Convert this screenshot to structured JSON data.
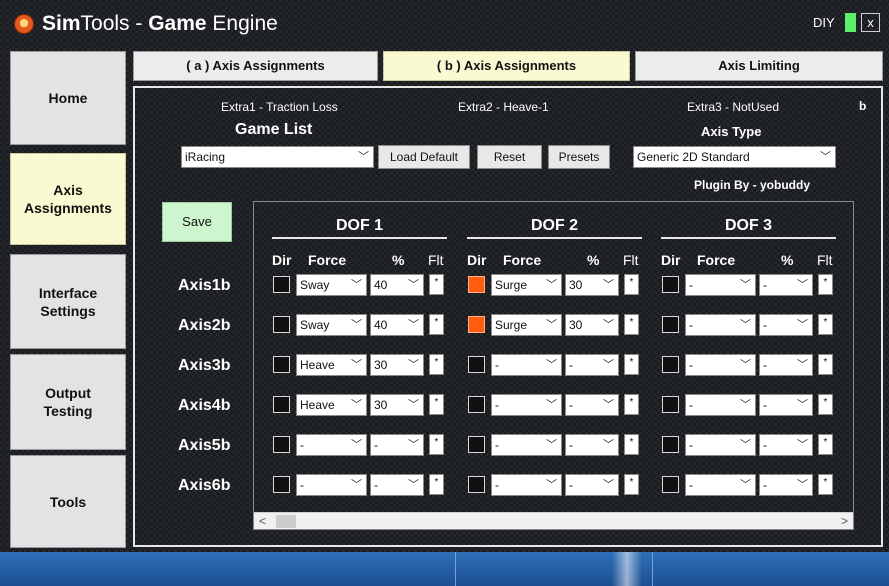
{
  "window": {
    "title_bold": "Sim",
    "title_light": "Tools",
    "title_sep": " - ",
    "title_bold2": "Game",
    "title_light2": " Engine",
    "diy_label": "DIY",
    "close_label": "x",
    "toggle_color": "#5cf06b"
  },
  "nav": [
    {
      "label": "Home",
      "active": false
    },
    {
      "label": "Axis\nAssignments",
      "active": true
    },
    {
      "label": "Interface\nSettings",
      "active": false
    },
    {
      "label": "Output\nTesting",
      "active": false
    },
    {
      "label": "Tools",
      "active": false
    }
  ],
  "tabs": [
    {
      "label": "( a ) Axis Assignments",
      "active": false
    },
    {
      "label": "( b ) Axis Assignments",
      "active": true
    },
    {
      "label": "Axis Limiting",
      "active": false
    }
  ],
  "extras": {
    "extra1": "Extra1 - Traction Loss",
    "extra2": "Extra2 - Heave-1",
    "extra3": "Extra3 - NotUsed",
    "corner": "b"
  },
  "game_list": {
    "label": "Game List",
    "selected": "iRacing",
    "load_default": "Load Default",
    "reset": "Reset",
    "presets": "Presets"
  },
  "axis_type": {
    "label": "Axis Type",
    "selected": "Generic 2D Standard",
    "plugin": "Plugin By - yobuddy"
  },
  "save_label": "Save",
  "dof_headers": [
    "DOF 1",
    "DOF 2",
    "DOF 3"
  ],
  "col_headers": {
    "dir": "Dir",
    "force": "Force",
    "pct": "%",
    "flt": "Flt"
  },
  "flt_mark": "*",
  "accent_color": "#ff5e0d",
  "axes": [
    {
      "name": "Axis1b",
      "dofs": [
        {
          "dir": false,
          "force": "Sway",
          "pct": "40"
        },
        {
          "dir": true,
          "force": "Surge",
          "pct": "30"
        },
        {
          "dir": false,
          "force": "-",
          "pct": "-"
        }
      ]
    },
    {
      "name": "Axis2b",
      "dofs": [
        {
          "dir": false,
          "force": "Sway",
          "pct": "40"
        },
        {
          "dir": true,
          "force": "Surge",
          "pct": "30"
        },
        {
          "dir": false,
          "force": "-",
          "pct": "-"
        }
      ]
    },
    {
      "name": "Axis3b",
      "dofs": [
        {
          "dir": false,
          "force": "Heave",
          "pct": "30"
        },
        {
          "dir": false,
          "force": "-",
          "pct": "-"
        },
        {
          "dir": false,
          "force": "-",
          "pct": "-"
        }
      ]
    },
    {
      "name": "Axis4b",
      "dofs": [
        {
          "dir": false,
          "force": "Heave",
          "pct": "30"
        },
        {
          "dir": false,
          "force": "-",
          "pct": "-"
        },
        {
          "dir": false,
          "force": "-",
          "pct": "-"
        }
      ]
    },
    {
      "name": "Axis5b",
      "dofs": [
        {
          "dir": false,
          "force": "-",
          "pct": "-"
        },
        {
          "dir": false,
          "force": "-",
          "pct": "-"
        },
        {
          "dir": false,
          "force": "-",
          "pct": "-"
        }
      ]
    },
    {
      "name": "Axis6b",
      "dofs": [
        {
          "dir": false,
          "force": "-",
          "pct": "-"
        },
        {
          "dir": false,
          "force": "-",
          "pct": "-"
        },
        {
          "dir": false,
          "force": "-",
          "pct": "-"
        }
      ]
    }
  ]
}
